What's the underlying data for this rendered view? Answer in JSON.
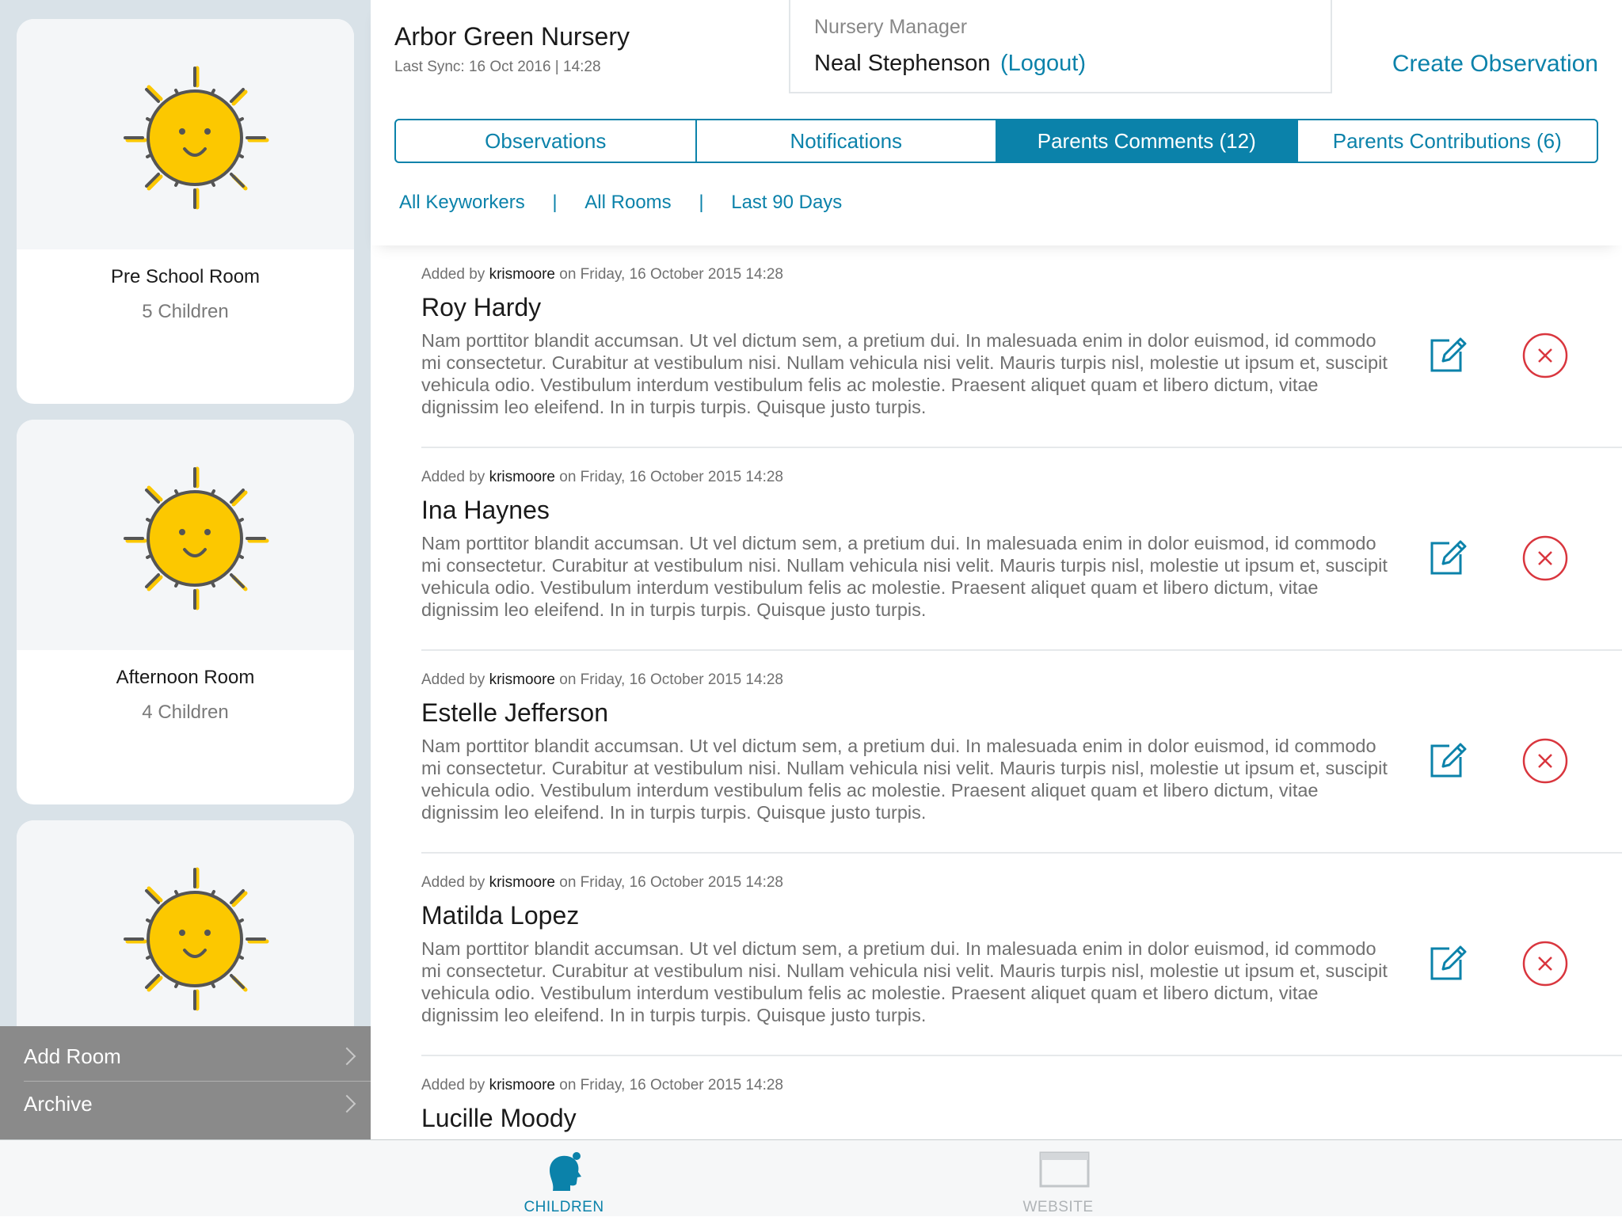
{
  "sidebar": {
    "rooms": [
      {
        "name": "Pre School Room",
        "count": "5 Children",
        "icon": "sun-icon"
      },
      {
        "name": "Afternoon Room",
        "count": "4 Children",
        "icon": "sun-icon"
      },
      {
        "name": "",
        "count": "",
        "icon": "sun-icon"
      }
    ],
    "menu": {
      "add_room": "Add Room",
      "archive": "Archive"
    }
  },
  "header": {
    "nursery_name": "Arbor Green Nursery",
    "last_sync": "Last Sync: 16 Oct 2016 | 14:28",
    "manager_role": "Nursery Manager",
    "manager_name": "Neal Stephenson",
    "logout": "(Logout)",
    "create_observation": "Create Observation"
  },
  "tabs": [
    {
      "label": "Observations",
      "active": false
    },
    {
      "label": "Notifications",
      "active": false
    },
    {
      "label": "Parents Comments (12)",
      "active": true
    },
    {
      "label": "Parents Contributions (6)",
      "active": false
    }
  ],
  "filters": {
    "keyworkers": "All Keyworkers",
    "separator": "|",
    "rooms": "All Rooms",
    "period": "Last 90 Days"
  },
  "comments": [
    {
      "meta_prefix": "Added by",
      "author": "krismoore",
      "meta_suffix": "on Friday, 16 October 2015 14:28",
      "child": "Roy Hardy",
      "text": "Nam porttitor blandit accumsan. Ut vel dictum sem, a pretium dui. In malesuada enim in dolor euismod, id commodo mi consectetur. Curabitur at vestibulum nisi. Nullam vehicula nisi velit. Mauris turpis nisl, molestie ut ipsum et, suscipit vehicula odio. Vestibulum interdum vestibulum felis ac molestie. Praesent aliquet quam et libero dictum, vitae dignissim leo eleifend. In in turpis turpis. Quisque justo turpis."
    },
    {
      "meta_prefix": "Added by",
      "author": "krismoore",
      "meta_suffix": "on Friday, 16 October 2015 14:28",
      "child": "Ina Haynes",
      "text": "Nam porttitor blandit accumsan. Ut vel dictum sem, a pretium dui. In malesuada enim in dolor euismod, id commodo mi consectetur. Curabitur at vestibulum nisi. Nullam vehicula nisi velit. Mauris turpis nisl, molestie ut ipsum et, suscipit vehicula odio. Vestibulum interdum vestibulum felis ac molestie. Praesent aliquet quam et libero dictum, vitae dignissim leo eleifend. In in turpis turpis. Quisque justo turpis."
    },
    {
      "meta_prefix": "Added by",
      "author": "krismoore",
      "meta_suffix": "on Friday, 16 October 2015 14:28",
      "child": "Estelle Jefferson",
      "text": "Nam porttitor blandit accumsan. Ut vel dictum sem, a pretium dui. In malesuada enim in dolor euismod, id commodo mi consectetur. Curabitur at vestibulum nisi. Nullam vehicula nisi velit. Mauris turpis nisl, molestie ut ipsum et, suscipit vehicula odio. Vestibulum interdum vestibulum felis ac molestie. Praesent aliquet quam et libero dictum, vitae dignissim leo eleifend. In in turpis turpis. Quisque justo turpis."
    },
    {
      "meta_prefix": "Added by",
      "author": "krismoore",
      "meta_suffix": "on Friday, 16 October 2015 14:28",
      "child": "Matilda Lopez",
      "text": "Nam porttitor blandit accumsan. Ut vel dictum sem, a pretium dui. In malesuada enim in dolor euismod, id commodo mi consectetur. Curabitur at vestibulum nisi. Nullam vehicula nisi velit. Mauris turpis nisl, molestie ut ipsum et, suscipit vehicula odio. Vestibulum interdum vestibulum felis ac molestie. Praesent aliquet quam et libero dictum, vitae dignissim leo eleifend. In in turpis turpis. Quisque justo turpis."
    },
    {
      "meta_prefix": "Added by",
      "author": "krismoore",
      "meta_suffix": "on Friday, 16 October 2015 14:28",
      "child": "Lucille Moody",
      "text": ""
    }
  ],
  "tabbar": [
    {
      "label": "CHILDREN",
      "icon": "child-head-icon",
      "active": true
    },
    {
      "label": "WEBSITE",
      "icon": "browser-window-icon",
      "active": false
    }
  ],
  "colors": {
    "accent": "#0b82aa",
    "delete": "#d9363e",
    "sun": "#fcc800",
    "sidebar_bg": "#d9e2e8",
    "menu_bg": "#8a8a8a"
  }
}
